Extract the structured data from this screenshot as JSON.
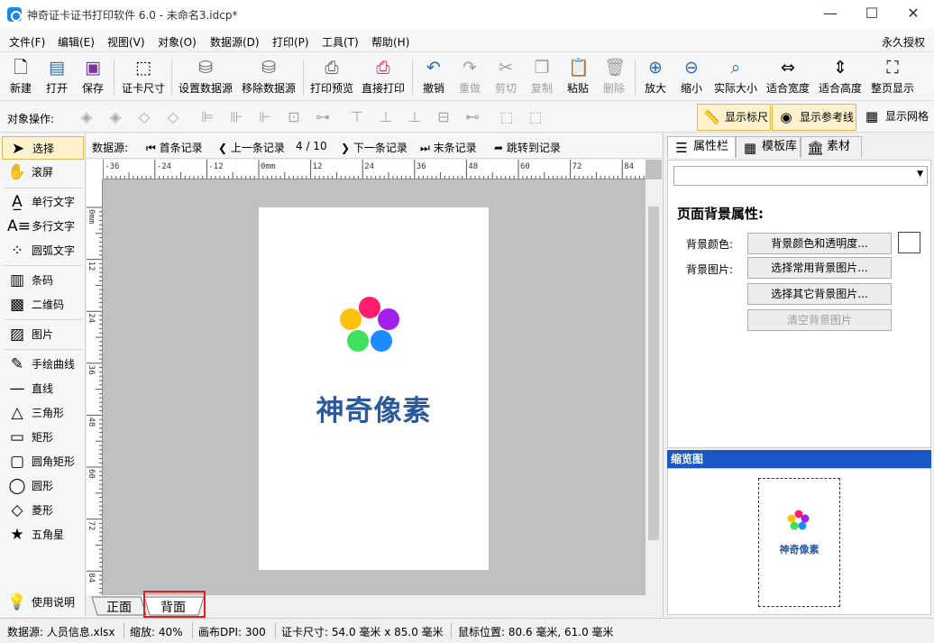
{
  "window": {
    "title": "神奇证卡证书打印软件 6.0 - 未命名3.idcp*",
    "minimize": "—",
    "maximize": "☐",
    "close": "✕"
  },
  "menu": {
    "items": [
      "文件(F)",
      "编辑(E)",
      "视图(V)",
      "对象(O)",
      "数据源(D)",
      "打印(P)",
      "工具(T)",
      "帮助(H)"
    ],
    "license": "永久授权"
  },
  "toolbar": {
    "new": "新建",
    "open": "打开",
    "save": "保存",
    "card_size": "证卡尺寸",
    "set_datasource": "设置数据源",
    "remove_datasource": "移除数据源",
    "print_preview": "打印预览",
    "direct_print": "直接打印",
    "undo": "撤销",
    "redo": "重做",
    "cut": "剪切",
    "copy": "复制",
    "paste": "粘贴",
    "delete": "删除",
    "zoom_in": "放大",
    "zoom_out": "缩小",
    "actual_size": "实际大小",
    "fit_width": "适合宽度",
    "fit_height": "适合高度",
    "full_page": "整页显示"
  },
  "toolbar2": {
    "label": "对象操作:",
    "show_ruler": "显示标尺",
    "show_guides": "显示参考线",
    "show_grid": "显示网格"
  },
  "tools": {
    "select": "选择",
    "scroll": "滚屏",
    "single_text": "单行文字",
    "multi_text": "多行文字",
    "arc_text": "圆弧文字",
    "barcode": "条码",
    "qrcode": "二维码",
    "image": "图片",
    "freehand": "手绘曲线",
    "line": "直线",
    "triangle": "三角形",
    "rectangle": "矩形",
    "round_rect": "圆角矩形",
    "circle": "圆形",
    "diamond": "菱形",
    "star": "五角星",
    "help": "使用说明"
  },
  "nav": {
    "label": "数据源:",
    "first": "首条记录",
    "prev": "上一条记录",
    "position": "4 / 10",
    "next": "下一条记录",
    "last": "末条记录",
    "jump": "跳转到记录"
  },
  "ruler": {
    "h_ticks": [
      "-36",
      "-24",
      "-12",
      "0mm",
      "12",
      "24",
      "36",
      "48",
      "60",
      "72",
      "84"
    ],
    "v_ticks": [
      "0mm",
      "12",
      "24",
      "36",
      "48",
      "60",
      "72",
      "84"
    ]
  },
  "card": {
    "logo_text": "神奇像素",
    "dot_colors": [
      "#ff1d6e",
      "#a21ff0",
      "#ffc20e",
      "#3fe05c",
      "#1e8cff"
    ],
    "text_color": "#2a5a9c"
  },
  "page_tabs": {
    "front": "正面",
    "back": "背面"
  },
  "right": {
    "tabs": {
      "properties": "属性栏",
      "templates": "模板库",
      "materials": "素材库"
    },
    "section_title": "页面背景属性:",
    "bg_color_label": "背景颜色:",
    "bg_color_button": "背景颜色和透明度...",
    "bg_image_label": "背景图片:",
    "common_bg_button": "选择常用背景图片...",
    "other_bg_button": "选择其它背景图片...",
    "clear_bg_button": "清空背景图片",
    "thumbnail_title": "缩览图"
  },
  "status": {
    "datasource": "数据源: 人员信息.xlsx",
    "zoom": "缩放: 40%",
    "dpi": "画布DPI: 300",
    "card_size": "证卡尺寸: 54.0 毫米 x 85.0 毫米",
    "mouse": "鼠标位置: 80.6 毫米, 61.0 毫米"
  }
}
